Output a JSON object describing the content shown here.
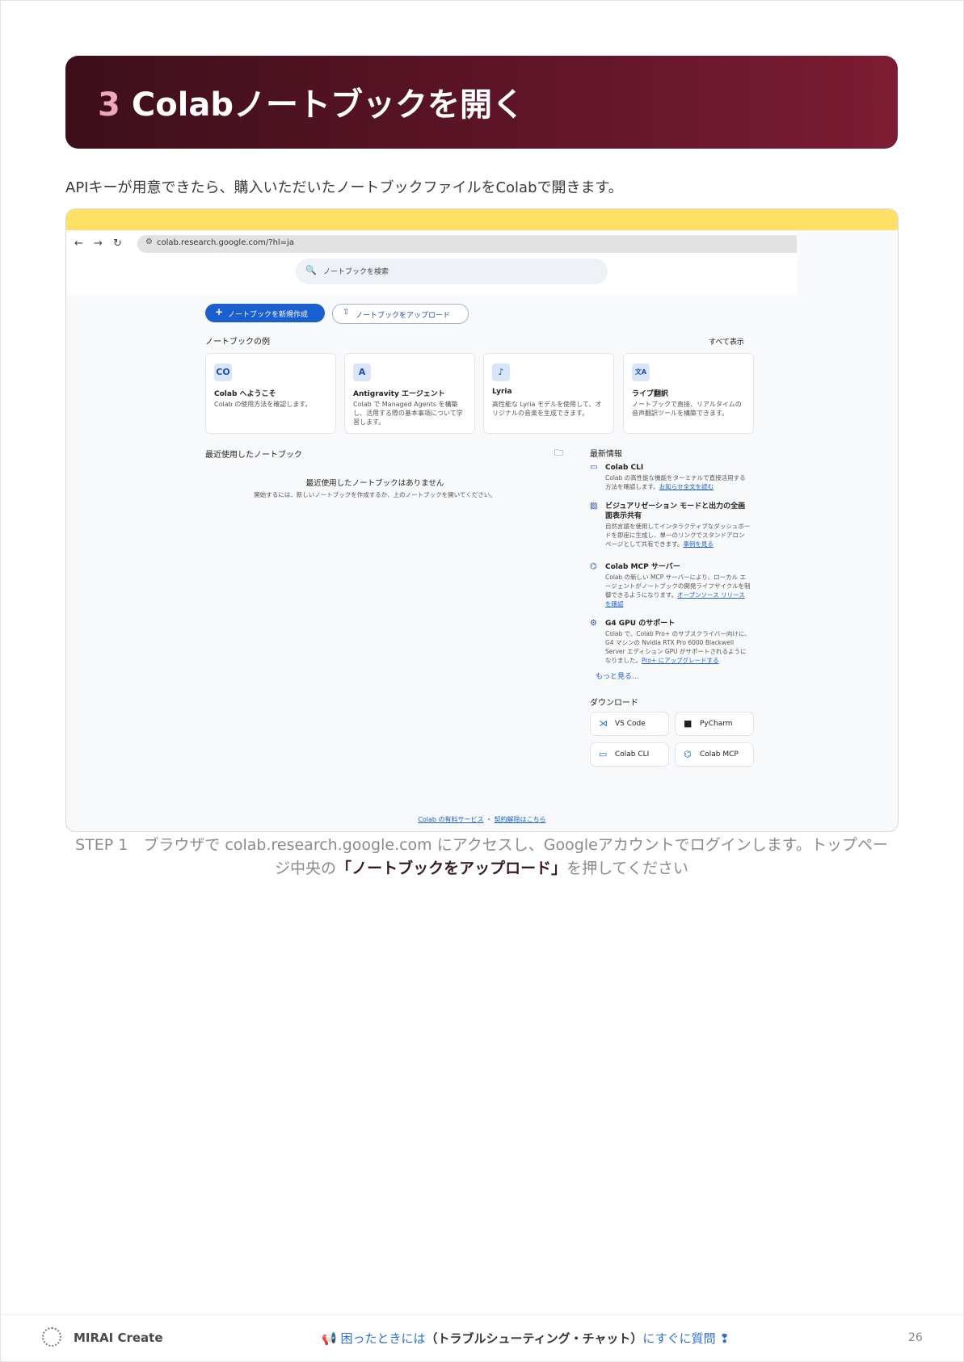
{
  "header": {
    "number": "3",
    "title": "Colabノートブックを開く"
  },
  "intro": "APIキーが用意できたら、購入いただいたノートブックファイルをColabで開きます。",
  "screenshot": {
    "url": "colab.research.google.com/?hl=ja",
    "search_placeholder": "ノートブックを検索",
    "new_notebook": "ノートブックを新規作成",
    "upload_notebook": "ノートブックをアップロード",
    "examples_title": "ノートブックの例",
    "see_all": "すべて表示",
    "cards": [
      {
        "icon": "CO",
        "title": "Colab へようこそ",
        "desc": "Colab の使用方法を確認します。"
      },
      {
        "icon": "A",
        "title": "Antigravity エージェント",
        "desc": "Colab で Managed Agents を構築し、活用する際の基本事項について学習します。"
      },
      {
        "icon": "♪",
        "title": "Lyria",
        "desc": "高性能な Lyria モデルを使用して、オリジナルの音楽を生成できます。"
      },
      {
        "icon": "文A",
        "title": "ライブ翻訳",
        "desc": "ノートブックで直接、リアルタイムの音声翻訳ツールを構築できます。"
      }
    ],
    "recent_title": "最近使用したノートブック",
    "empty_title": "最近使用したノートブックはありません",
    "empty_sub": "開始するには、新しいノートブックを作成するか、上のノートブックを開いてください。",
    "news_title": "最新情報",
    "news": [
      {
        "title": "Colab CLI",
        "desc": "Colab の高性能な機能をターミナルで直接活用する方法を確認します。",
        "link": "お知らせ全文を読む"
      },
      {
        "title": "ビジュアリゼーション モードと出力の全画面表示共有",
        "desc": "自然言語を使用してインタラクティブなダッシュボードを即座に生成し、単一のリンクでスタンドアロン ページとして共有できます。",
        "link": "事例を見る"
      },
      {
        "title": "Colab MCP サーバー",
        "desc": "Colab の新しい MCP サーバーにより、ローカル エージェントがノートブックの開発ライフサイクルを制御できるようになります。",
        "link": "オープンソース リリースを確認"
      },
      {
        "title": "G4 GPU のサポート",
        "desc": "Colab で、Colab Pro+ のサブスクライバー向けに、G4 マシンの Nvidia RTX Pro 6000 Blackwell Server エディション GPU がサポートされるようになりました。",
        "link": "Pro+ にアップグレードする"
      }
    ],
    "more": "もっと見る...",
    "downloads_title": "ダウンロード",
    "downloads": [
      "VS Code",
      "PyCharm",
      "Colab CLI",
      "Colab MCP"
    ],
    "footer_terms": "Colab の有料サービス",
    "footer_sep": "・",
    "footer_cancel": "契約解除はこちら"
  },
  "caption": {
    "pre": "STEP 1　ブラウザで colab.research.google.com にアクセスし、Googleアカウントでログインします。トップページ中央の",
    "bold": "「ノートブックをアップロード」",
    "post": "を押してください"
  },
  "footer": {
    "brand": "MIRAI Create",
    "help_pre": "困ったときには",
    "help_bold": "（トラブルシューティング・チャット）",
    "help_post": "にすぐに質問",
    "page": "26"
  },
  "colors": {
    "banner_start": "#3c0f1a",
    "banner_end": "#7c1c33",
    "accent_blue": "#1a5fd0",
    "screenshot_top": "#ffe066"
  }
}
